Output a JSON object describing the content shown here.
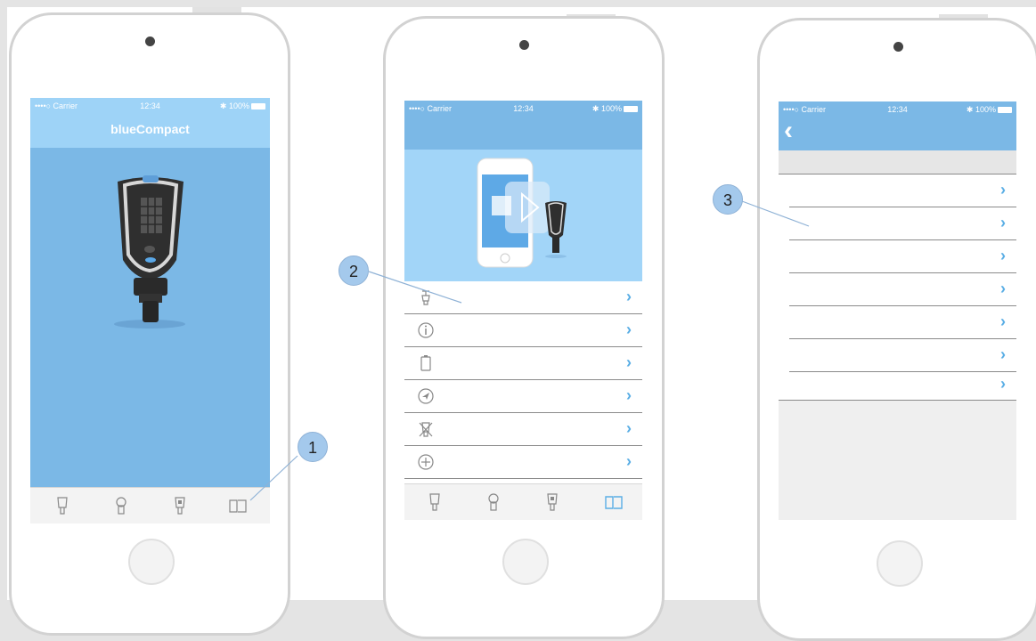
{
  "status_bar": {
    "carrier": "••••○ Carrier",
    "time": "12:34",
    "battery": "100%"
  },
  "screen1": {
    "title": "blueCompact",
    "product": "key-fob-image"
  },
  "screen2": {
    "hero": "phone-and-key-illustration",
    "menu_icons": [
      "reset-icon",
      "info-icon",
      "battery-icon",
      "compass-icon",
      "delete-icon",
      "add-icon"
    ]
  },
  "screen3": {
    "back": "‹"
  },
  "tabs": [
    "key-icon",
    "cylinder-icon",
    "transponder-icon",
    "book-icon"
  ],
  "callouts": [
    "1",
    "2",
    "3"
  ],
  "colors": {
    "accent": "#7bb8e6",
    "navbar": "#9ed3f7",
    "chevron": "#5aaee5",
    "badge": "#a4c9ec"
  }
}
